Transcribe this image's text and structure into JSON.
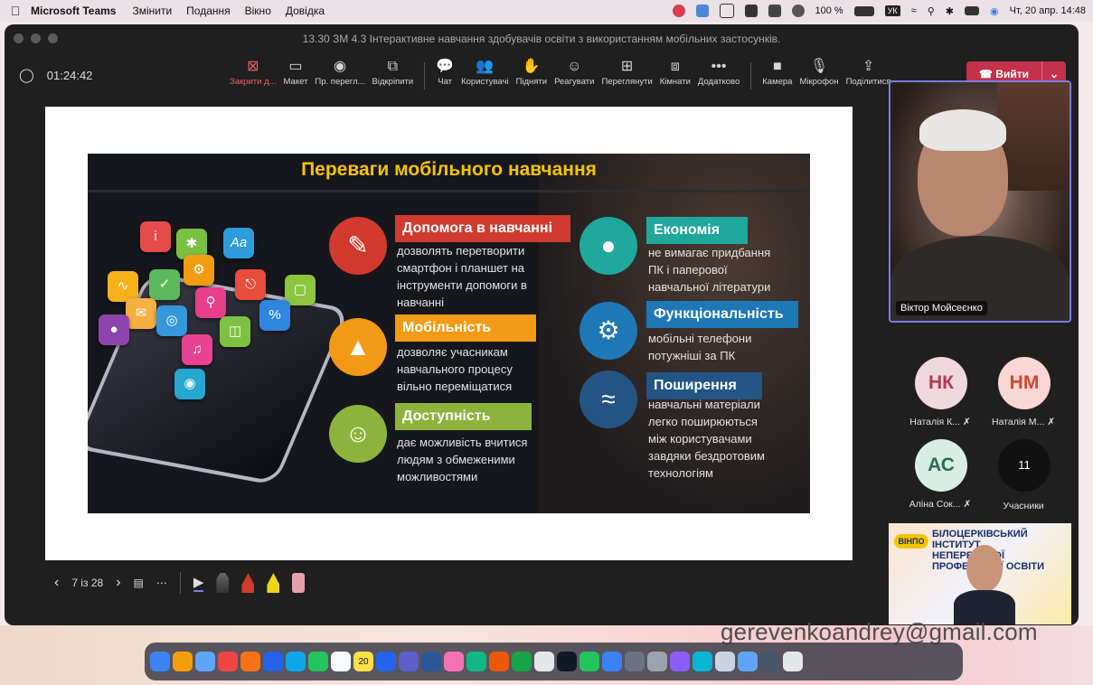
{
  "menubar": {
    "app": "Microsoft Teams",
    "items": [
      "Змінити",
      "Подання",
      "Вікно",
      "Довідка"
    ],
    "battery": "100 %",
    "layout": "УК",
    "datetime": "Чт, 20 апр.  14:48"
  },
  "window": {
    "title": "13.30 ЗМ 4.3 Інтерактивне навчання здобувачів освіти з використанням мобільних застосунків."
  },
  "toolbar": {
    "timer": "01:24:42",
    "tools": [
      {
        "icon": "close-share-icon",
        "glyph": "⊠",
        "label": "Закрити д..."
      },
      {
        "icon": "layout-icon",
        "glyph": "▭",
        "label": "Макет"
      },
      {
        "icon": "presenter-view-icon",
        "glyph": "◉",
        "label": "Пр. перегл..."
      },
      {
        "icon": "pop-out-icon",
        "glyph": "⧉",
        "label": "Відкріпити"
      }
    ],
    "tools2": [
      {
        "icon": "chat-icon",
        "glyph": "💬",
        "label": "Чат"
      },
      {
        "icon": "people-icon",
        "glyph": "👥",
        "label": "Користувачі"
      },
      {
        "icon": "raise-hand-icon",
        "glyph": "✋",
        "label": "Підняти"
      },
      {
        "icon": "react-icon",
        "glyph": "☺",
        "label": "Реагувати"
      },
      {
        "icon": "view-icon",
        "glyph": "⊞",
        "label": "Переглянути"
      },
      {
        "icon": "rooms-icon",
        "glyph": "⧈",
        "label": "Кімнати"
      },
      {
        "icon": "more-icon",
        "glyph": "•••",
        "label": "Додатково"
      }
    ],
    "tools3": [
      {
        "icon": "camera-icon",
        "glyph": "■",
        "label": "Камера"
      },
      {
        "icon": "microphone-icon",
        "glyph": "🎙",
        "label": "Мікрофон"
      },
      {
        "icon": "share-icon",
        "glyph": "⇪",
        "label": "Поділитися"
      }
    ],
    "leave": "Вийти"
  },
  "slide": {
    "title": "Переваги мобільного навчання",
    "items": [
      {
        "header": "Допомога в навчанні",
        "desc": [
          "дозволять перетворити",
          "смартфон і планшет на",
          "інструменти допомоги в",
          "навчанні"
        ],
        "color": "#d13a2e"
      },
      {
        "header": "Мобільність",
        "desc": [
          "дозволяє учасникам",
          "навчального процесу",
          "вільно переміщатися"
        ],
        "color": "#f29a16"
      },
      {
        "header": "Доступність",
        "desc": [
          "дає можливість вчитися",
          "людям з обмеженими",
          "можливостями"
        ],
        "color": "#8cb43c"
      },
      {
        "header": "Економія",
        "desc": [
          "не вимагає придбання",
          "ПК і паперової",
          "навчальної літератури"
        ],
        "color": "#1fa89c"
      },
      {
        "header": "Функціональність",
        "desc": [
          "мобільні телефони",
          "потужніші за ПК"
        ],
        "color": "#1f78b6"
      },
      {
        "header": "Поширення",
        "desc": [
          "навчальні матеріали",
          "легко поширюються",
          "між користувачами",
          "завдяки бездротовим",
          "технологіям"
        ],
        "color": "#225583"
      }
    ]
  },
  "slide_controls": {
    "page": "7 із 28"
  },
  "participants": {
    "main_speaker": "Віктор Мойсеєнко",
    "tiles": [
      {
        "initials": "НК",
        "name": "Наталія К..."
      },
      {
        "initials": "НМ",
        "name": "Наталія М..."
      },
      {
        "initials": "АС",
        "name": "Аліна Сок..."
      }
    ],
    "count": "11",
    "count_label": "Учасники"
  },
  "self_video": {
    "logo": "ВІНПО",
    "title_line1": "БІЛОЦЕРКІВСЬКИЙ ІНСТИТУТ",
    "title_line2": "НЕПЕРЕРВНОЇ ПРОФЕСІЙНОЇ ОСВІТИ"
  },
  "overlay_email": "gerevenkoandrey@gmail.com",
  "dock": {
    "calendar_day": "20"
  },
  "colors": {
    "accent_red": "#c4314b",
    "speaker_border": "#7a7ce6",
    "slide_title": "#f5c400"
  }
}
